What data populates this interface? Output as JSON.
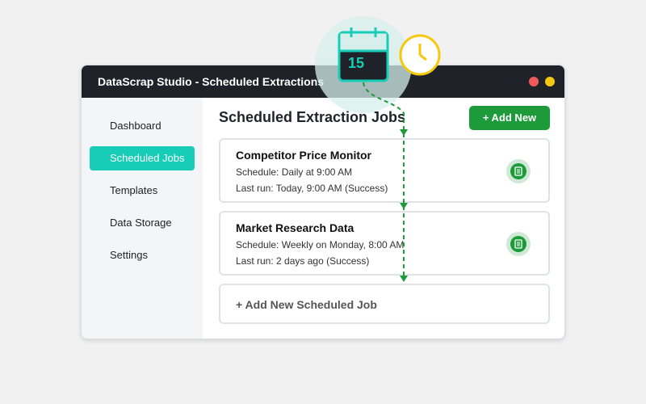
{
  "window": {
    "title": "DataScrap Studio - Scheduled Extractions"
  },
  "sidebar": {
    "items": [
      {
        "label": "Dashboard",
        "active": false
      },
      {
        "label": "Scheduled Jobs",
        "active": true
      },
      {
        "label": "Templates",
        "active": false
      },
      {
        "label": "Data Storage",
        "active": false
      },
      {
        "label": "Settings",
        "active": false
      }
    ]
  },
  "main": {
    "title": "Scheduled Extraction Jobs",
    "add_button_label": "+ Add New",
    "jobs": [
      {
        "name": "Competitor Price Monitor",
        "schedule": "Schedule: Daily at 9:00 AM",
        "last_run": "Last run: Today, 9:00 AM (Success)",
        "icon": "server-icon"
      },
      {
        "name": "Market Research Data",
        "schedule": "Schedule: Weekly on Monday, 8:00 AM",
        "last_run": "Last run: 2 days ago (Success)",
        "icon": "server-icon"
      }
    ],
    "add_job_label": "+ Add New Scheduled Job"
  },
  "overlay": {
    "calendar_day": "15",
    "calendar_icon": "calendar-icon",
    "clock_icon": "clock-icon"
  },
  "colors": {
    "accent_teal": "#18cdb7",
    "accent_green": "#1d9a3a",
    "titlebar_bg": "#1f2329",
    "clock_yellow": "#f6c90e"
  }
}
